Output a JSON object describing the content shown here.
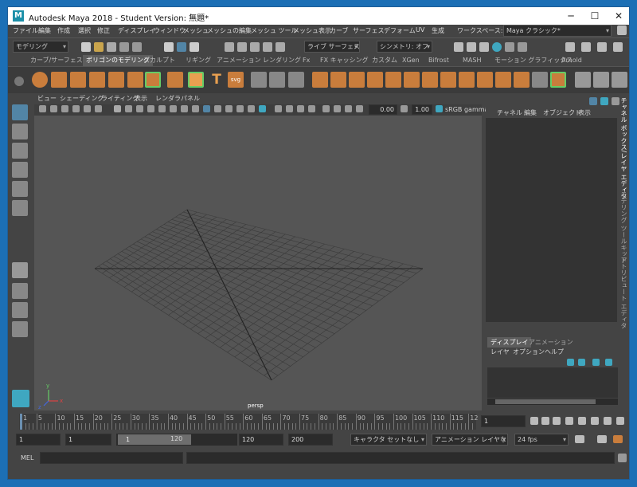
{
  "window": {
    "title": "Autodesk Maya 2018 - Student Version: 無題*",
    "logo_letter": "M"
  },
  "menubar": {
    "items": [
      "ファイル",
      "編集",
      "作成",
      "選択",
      "修正",
      "ディスプレイ",
      "ウィンドウ",
      "メッシュ",
      "メッシュの編集",
      "メッシュ ツール",
      "メッシュ表示",
      "カーブ",
      "サーフェス",
      "デフォーム",
      "UV",
      "生成"
    ],
    "workspace_label": "ワークスペース:",
    "workspace_value": "Maya クラシック*"
  },
  "toolbar": {
    "mode": "モデリング",
    "live_surface": "ライブ サーフェスなし",
    "symmetry": "シンメトリ: オフ"
  },
  "shelf": {
    "tabs": [
      "カーブ/サーフェス",
      "ポリゴンのモデリング",
      "スカルプト",
      "リギング",
      "アニメーション",
      "レンダリング",
      "Fx",
      "FX キャッシング",
      "カスタム",
      "XGen",
      "Bifrost",
      "MASH",
      "モーション グラフィックス",
      "Arnold"
    ],
    "active_tab": "ポリゴンのモデリング",
    "text_icon": "T",
    "svg_icon": "svg"
  },
  "viewport": {
    "menu": [
      "ビュー",
      "シェーディング",
      "ライティング",
      "表示",
      "レンダラ",
      "パネル"
    ],
    "value1": "0.00",
    "value2": "1.00",
    "colorspace": "sRGB gamma",
    "camera_label": "persp",
    "axis_x": "x",
    "axis_y": "y",
    "axis_z": "z"
  },
  "channel_box": {
    "menu": [
      "チャネル",
      "編集",
      "オブジェクト",
      "表示"
    ]
  },
  "right_tabs": [
    "チャネル ボックス/レイヤ エディタ",
    "モデリング ツールキット",
    "アトリビュート エディタ"
  ],
  "layers": {
    "tabs": [
      "ディスプレイ",
      "アニメーション"
    ],
    "active_tab": "ディスプレイ",
    "menu": [
      "レイヤ",
      "オプション",
      "ヘルプ"
    ]
  },
  "timeline": {
    "ticks": [
      "1",
      "5",
      "10",
      "15",
      "20",
      "25",
      "30",
      "35",
      "40",
      "45",
      "50",
      "55",
      "60",
      "65",
      "70",
      "75",
      "80",
      "85",
      "90",
      "95",
      "100",
      "105",
      "110",
      "115",
      "12"
    ],
    "current_frame": "1"
  },
  "range": {
    "start": "1",
    "playback_start": "1",
    "slider_start": "1",
    "slider_end": "120",
    "playback_end": "120",
    "end": "200",
    "character_set": "キャラクタ セットなし",
    "anim_layer": "アニメーション レイヤなし",
    "fps": "24 fps"
  },
  "command": {
    "label": "MEL"
  },
  "colors": {
    "accent": "#5285a6",
    "orange": "#c97d3c",
    "teal": "#3fa7c0"
  }
}
